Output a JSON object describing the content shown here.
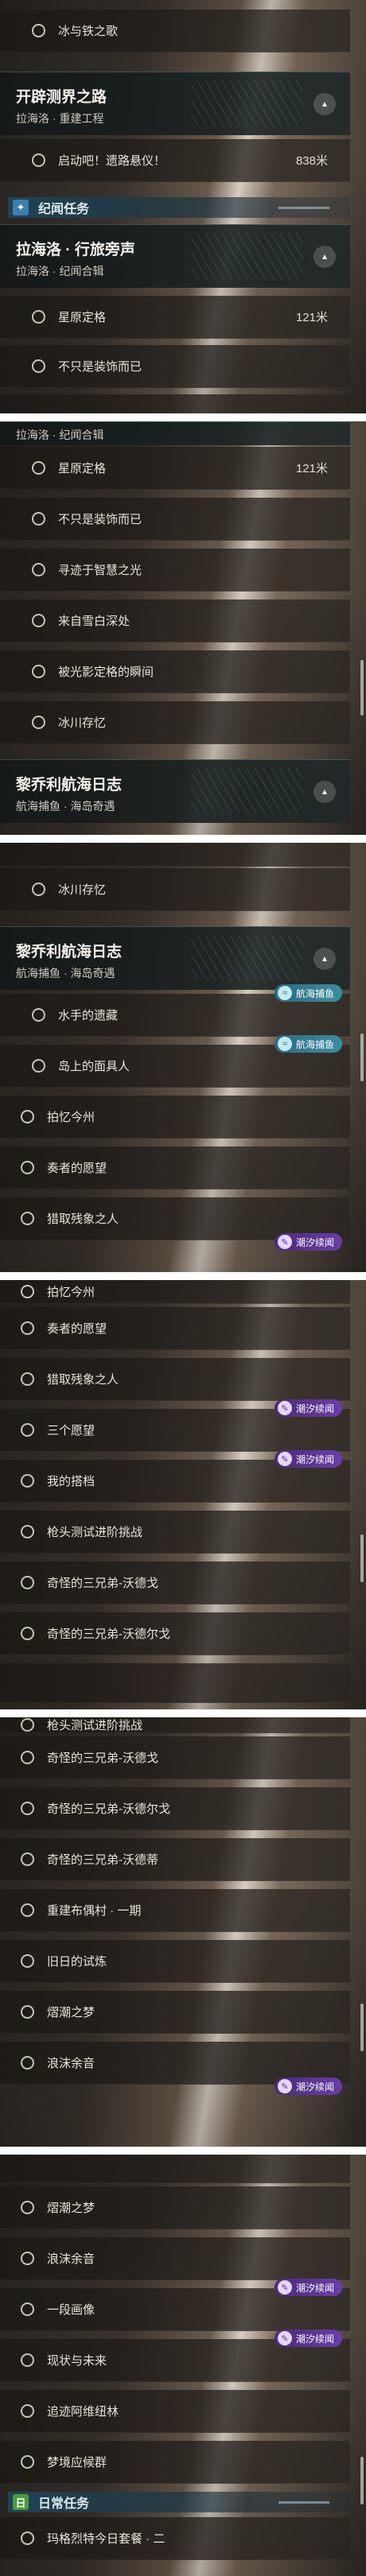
{
  "ui": {
    "collapse_glyph": "▲",
    "section_glyph_world": "✦",
    "section_glyph_daily": "日",
    "circle_icon": "circle-outline"
  },
  "sections": {
    "world": "纪闻任务",
    "daily": "日常任务"
  },
  "quests": {
    "kaipi": {
      "title": "开辟测界之路",
      "sub": "拉海洛 · 重建工程"
    },
    "lahailuo": {
      "title": "拉海洛 · 行旅旁声",
      "sub": "拉海洛 · 纪闻合辑"
    },
    "liqiaoli": {
      "title": "黎乔利航海日志",
      "sub": "航海捕鱼 · 海岛奇遇"
    }
  },
  "tasks": {
    "bingtie": "冰与铁之歌",
    "qidong": "启动吧！遗路悬仪！",
    "xingyuan": "星原定格",
    "bu_zhi": "不只是装饰而已",
    "xunji": "寻迹于智慧之光",
    "laizi": "来自雪白深处",
    "beiguang": "被光影定格的瞬间",
    "bingchuan": "冰川存忆",
    "shuishou": "水手的遗藏",
    "daoshang": "岛上的面具人",
    "paiyi": "拍忆今州",
    "zouzhe": "奏者的愿望",
    "lieqv": "猎取残象之人",
    "sange": "三个愿望",
    "wode": "我的搭档",
    "qiangtou": "枪头测试进阶挑战",
    "woduoge": "奇怪的三兄弟-沃德戈",
    "woduoer": "奇怪的三兄弟-沃德尔戈",
    "woduodi": "奇怪的三兄弟-沃德蒂",
    "chongjian": "重建布偶村 · 一期",
    "jiuri": "旧日的试炼",
    "xichao": "熠潮之梦",
    "langmo": "浪沫余音",
    "yiduan": "一段画像",
    "xianzhuang": "现状与未来",
    "zhuiyi": "追迹阿维纽林",
    "mengjing": "梦境应候群",
    "maige": "玛格烈特今日套餐 · 二"
  },
  "distances": {
    "qidong": "838米",
    "xingyuan": "121米"
  },
  "badges": {
    "sea": "航海捕鱼",
    "tide": "潮汐续闻"
  },
  "colors": {
    "section_world": "#3c7fae",
    "section_daily": "#4a9a3a",
    "badge_sea": "#2c6a80",
    "badge_tide": "#5a2f96"
  }
}
